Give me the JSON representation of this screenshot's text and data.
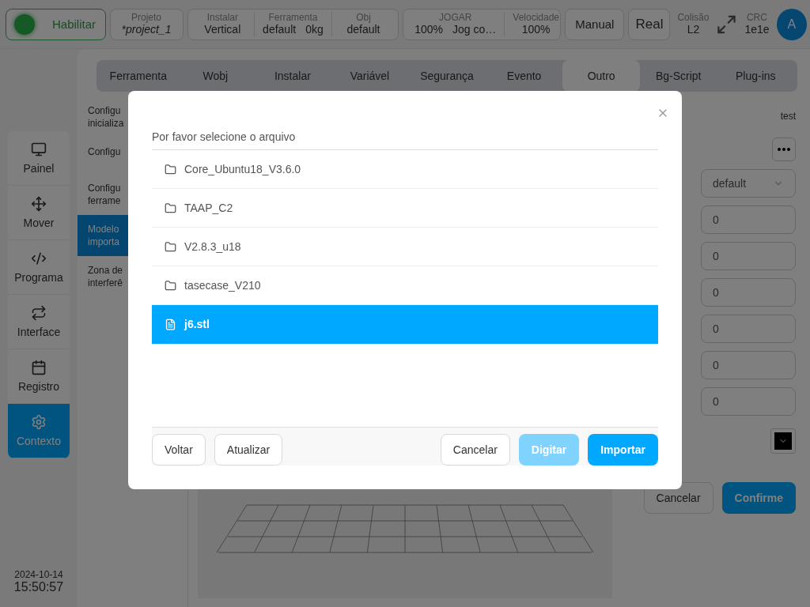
{
  "top_bar": {
    "enable_button": "Habilitar",
    "project": {
      "label": "Projeto",
      "value": "*project_1"
    },
    "install_group": [
      {
        "label": "Instalar",
        "values": [
          "Vertical"
        ]
      },
      {
        "label": "Ferramenta",
        "values": [
          "default",
          "0kg"
        ]
      },
      {
        "label": "Obj",
        "values": [
          "default"
        ]
      }
    ],
    "jog_group": [
      {
        "label": "JOGAR",
        "values": [
          "100%",
          "Jog co…"
        ]
      },
      {
        "label": "Velocidade",
        "values": [
          "100%"
        ]
      }
    ],
    "mode_buttons": [
      "Manual",
      "Real"
    ],
    "collision": {
      "label": "Colisão",
      "value": "L2"
    },
    "crc": {
      "label": "CRC",
      "value": "1e1e"
    },
    "avatar": "A"
  },
  "nav": [
    {
      "label": "Painel",
      "selected": false
    },
    {
      "label": "Mover",
      "selected": false
    },
    {
      "label": "Programa",
      "selected": false
    },
    {
      "label": "Interface",
      "selected": false
    },
    {
      "label": "Registro",
      "selected": false
    },
    {
      "label": "Contexto",
      "selected": true
    }
  ],
  "datetime": {
    "date": "2024-10-14",
    "time": "15:50:57"
  },
  "tabs": [
    {
      "label": "Ferramenta",
      "selected": false
    },
    {
      "label": "Wobj",
      "selected": false
    },
    {
      "label": "Instalar",
      "selected": false
    },
    {
      "label": "Variável",
      "selected": false
    },
    {
      "label": "Segurança",
      "selected": false
    },
    {
      "label": "Evento",
      "selected": false
    },
    {
      "label": "Outro",
      "selected": true
    },
    {
      "label": "Bg-Script",
      "selected": false
    },
    {
      "label": "Plug-ins",
      "selected": false
    }
  ],
  "settings_list": [
    {
      "label": "Configu\ninicializa",
      "selected": false
    },
    {
      "label": "Configu",
      "selected": false
    },
    {
      "label": "Configu\nferrame",
      "selected": false
    },
    {
      "label": "Modelo\nimporta",
      "selected": true
    },
    {
      "label": "Zona de\ninterferê",
      "selected": false
    }
  ],
  "right_panel": {
    "name": "test",
    "select": "default",
    "inputs": [
      "0",
      "0",
      "0",
      "0",
      "0",
      "0"
    ],
    "buttons": [
      {
        "label": "Cancelar",
        "kind": "default"
      },
      {
        "label": "Confirme",
        "kind": "primary"
      }
    ]
  },
  "dialog": {
    "title": "Por favor selecione o arquivo",
    "files": [
      {
        "name": "Core_Ubuntu18_V3.6.0",
        "kind": "folder",
        "selected": false
      },
      {
        "name": "TAAP_C2",
        "kind": "folder",
        "selected": false
      },
      {
        "name": "V2.8.3_u18",
        "kind": "folder",
        "selected": false
      },
      {
        "name": "tasecase_V210",
        "kind": "folder",
        "selected": false
      },
      {
        "name": "j6.stl",
        "kind": "file",
        "selected": true
      }
    ],
    "left_buttons": [
      {
        "label": "Voltar",
        "kind": "default",
        "disabled": false
      },
      {
        "label": "Atualizar",
        "kind": "default",
        "disabled": false
      }
    ],
    "right_buttons": [
      {
        "label": "Cancelar",
        "kind": "default",
        "disabled": false
      },
      {
        "label": "Digitar",
        "kind": "primary",
        "disabled": true
      },
      {
        "label": "Importar",
        "kind": "primary",
        "disabled": false
      }
    ]
  }
}
